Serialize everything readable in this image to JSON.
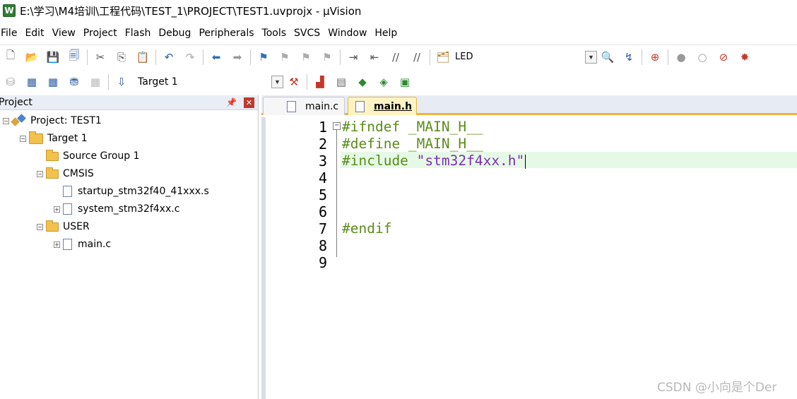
{
  "window": {
    "title": "E:\\学习\\M4培训\\工程代码\\TEST_1\\PROJECT\\TEST1.uvprojx - µVision",
    "app_icon_glyph": "W"
  },
  "menu": [
    "File",
    "Edit",
    "View",
    "Project",
    "Flash",
    "Debug",
    "Peripherals",
    "Tools",
    "SVCS",
    "Window",
    "Help"
  ],
  "toolbar1": {
    "led_label": "LED"
  },
  "toolbar2": {
    "target": "Target 1"
  },
  "project_panel": {
    "title": "Project",
    "tree": [
      {
        "label": "Project: TEST1",
        "depth": 0,
        "kind": "project",
        "expander": "−"
      },
      {
        "label": "Target 1",
        "depth": 1,
        "kind": "target",
        "expander": "−"
      },
      {
        "label": "Source Group 1",
        "depth": 2,
        "kind": "folder",
        "expander": ""
      },
      {
        "label": "CMSIS",
        "depth": 2,
        "kind": "folder-open",
        "expander": "−"
      },
      {
        "label": "startup_stm32f40_41xxx.s",
        "depth": 3,
        "kind": "file",
        "expander": ""
      },
      {
        "label": "system_stm32f4xx.c",
        "depth": 3,
        "kind": "file",
        "expander": "+"
      },
      {
        "label": "USER",
        "depth": 2,
        "kind": "folder-open",
        "expander": "−"
      },
      {
        "label": "main.c",
        "depth": 3,
        "kind": "file",
        "expander": "+"
      }
    ]
  },
  "editor": {
    "tabs": [
      {
        "label": "main.c",
        "active": false
      },
      {
        "label": "main.h",
        "active": true
      }
    ],
    "lines": [
      {
        "num": "1",
        "directive": "#ifndef",
        "rest": " _MAIN_H__"
      },
      {
        "num": "2",
        "directive": "#define",
        "rest": " _MAIN_H__"
      },
      {
        "num": "3",
        "directive": "#include",
        "rest": " \"stm32f4xx.h\""
      },
      {
        "num": "4",
        "directive": "",
        "rest": ""
      },
      {
        "num": "5",
        "directive": "",
        "rest": ""
      },
      {
        "num": "6",
        "directive": "",
        "rest": ""
      },
      {
        "num": "7",
        "directive": "#endif",
        "rest": ""
      },
      {
        "num": "8",
        "directive": "",
        "rest": ""
      },
      {
        "num": "9",
        "directive": "",
        "rest": ""
      }
    ],
    "current_line": 3
  },
  "watermark": "CSDN @小向是个Der",
  "colors": {
    "directive": "#5b8c1a",
    "string": "#7a2fb6",
    "current_line": "#e6f9e6",
    "tab_active": "#fff3c4",
    "tab_strip_accent": "#f2b33c"
  }
}
